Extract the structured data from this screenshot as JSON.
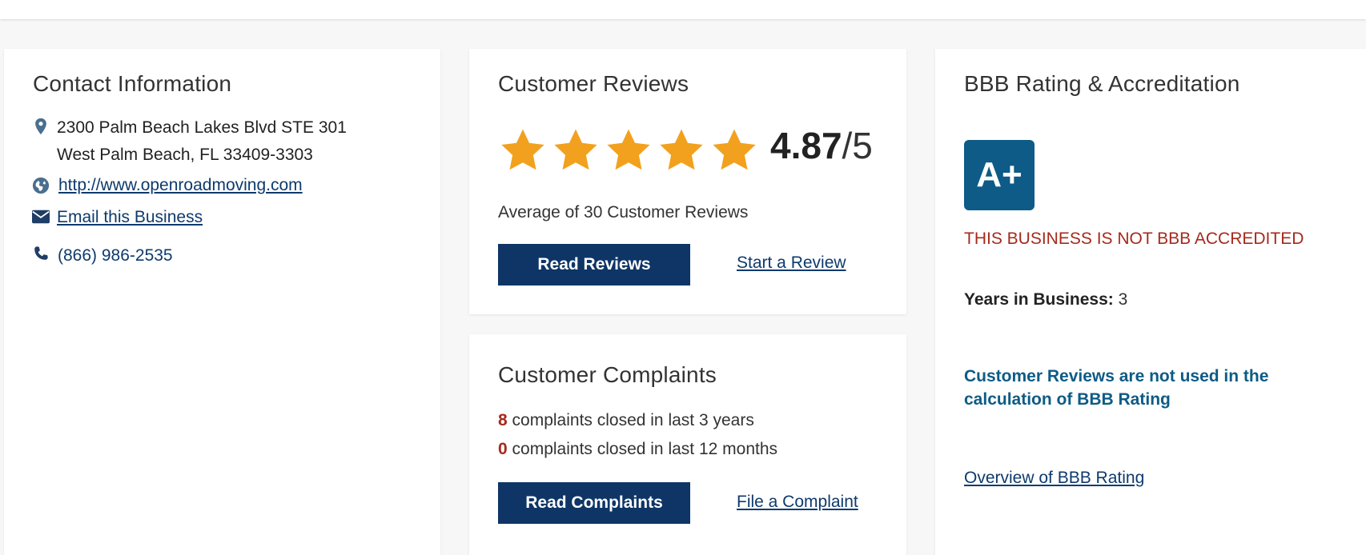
{
  "contact": {
    "title": "Contact Information",
    "address_line1": "2300 Palm Beach Lakes Blvd STE 301",
    "address_line2": "West Palm Beach, FL 33409-3303",
    "website": "http://www.openroadmoving.com",
    "email_label": "Email this Business",
    "phone": "(866) 986-2535",
    "icons": [
      "location-pin-icon",
      "globe-icon",
      "envelope-icon",
      "phone-icon"
    ]
  },
  "reviews": {
    "title": "Customer Reviews",
    "rating_value": "4.87",
    "rating_out_of": "/5",
    "stars_filled": 5,
    "average_text": "Average of 30 Customer Reviews",
    "read_button": "Read Reviews",
    "start_link": "Start a Review"
  },
  "complaints": {
    "title": "Customer Complaints",
    "count_3yr": "8",
    "text_3yr": " complaints closed in last 3 years",
    "count_12mo": "0",
    "text_12mo": " complaints closed in last 12 months",
    "read_button": "Read Complaints",
    "file_link": "File a Complaint"
  },
  "rating": {
    "title": "BBB Rating & Accreditation",
    "grade": "A+",
    "accreditation_status": "THIS BUSINESS IS NOT BBB ACCREDITED",
    "years_label": "Years in Business:",
    "years_value": " 3",
    "note": "Customer Reviews are not used in the calculation of BBB Rating",
    "overview_link": "Overview of BBB Rating"
  },
  "colors": {
    "star": "#f2a11e",
    "button": "#0e3566",
    "link": "#0e3a6c",
    "alert": "#a52a1c",
    "grade": "#0d5b86"
  }
}
